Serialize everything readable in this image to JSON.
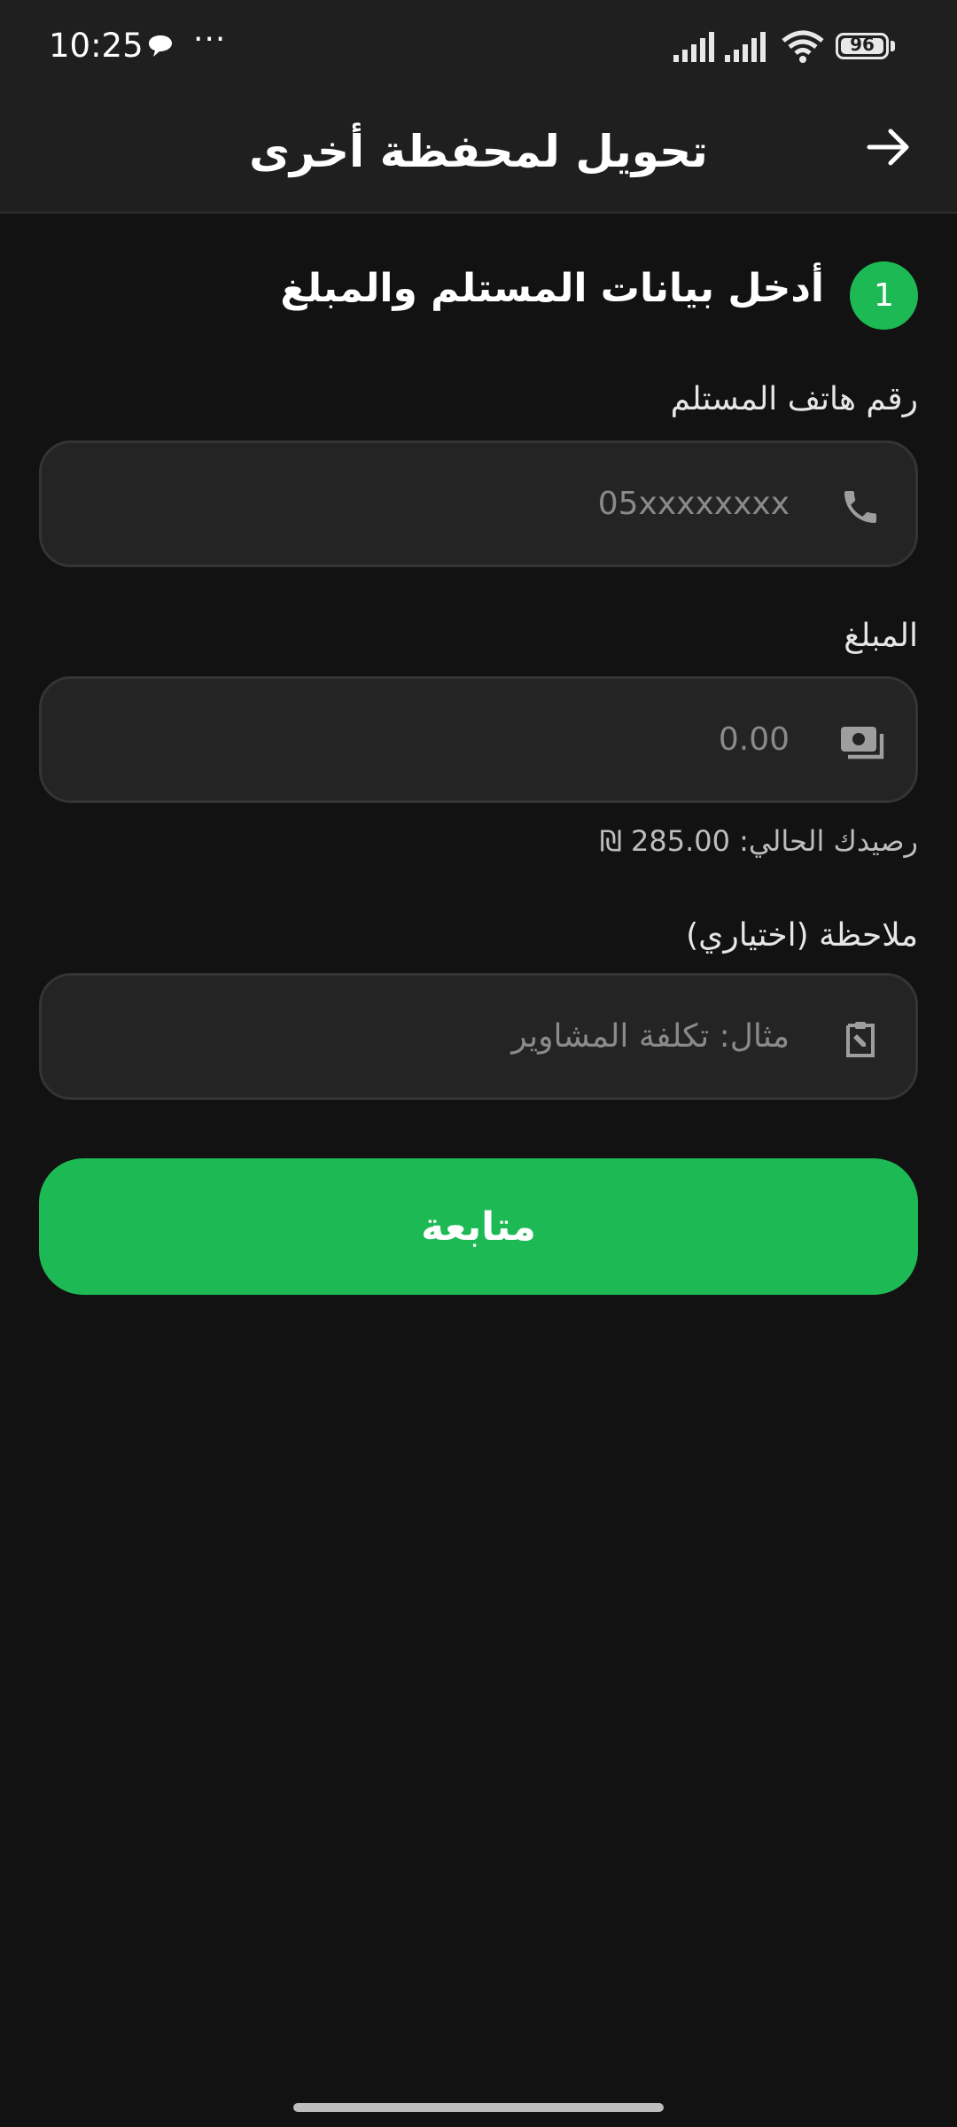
{
  "status_bar": {
    "time": "10:25",
    "dots": "···",
    "battery": "96"
  },
  "header": {
    "title": "تحويل لمحفظة أخرى"
  },
  "step": {
    "number": "1",
    "title": "أدخل بيانات المستلم والمبلغ"
  },
  "form": {
    "phone": {
      "label": "رقم هاتف المستلم",
      "placeholder": "05xxxxxxxx",
      "value": ""
    },
    "amount": {
      "label": "المبلغ",
      "placeholder": "0.00",
      "value": ""
    },
    "balance_text": "رصيدك الحالي: 285.00 ₪",
    "note": {
      "label": "ملاحظة (اختياري)",
      "placeholder": "مثال: تكلفة المشاوير",
      "value": ""
    }
  },
  "actions": {
    "continue_label": "متابعة"
  },
  "colors": {
    "accent": "#1db954",
    "background": "#121212",
    "surface": "#1f1f1f",
    "field": "#242424"
  },
  "icons": {
    "back": "arrow-right-icon",
    "phone": "phone-icon",
    "amount": "cash-icon",
    "note": "clipboard-edit-icon"
  }
}
